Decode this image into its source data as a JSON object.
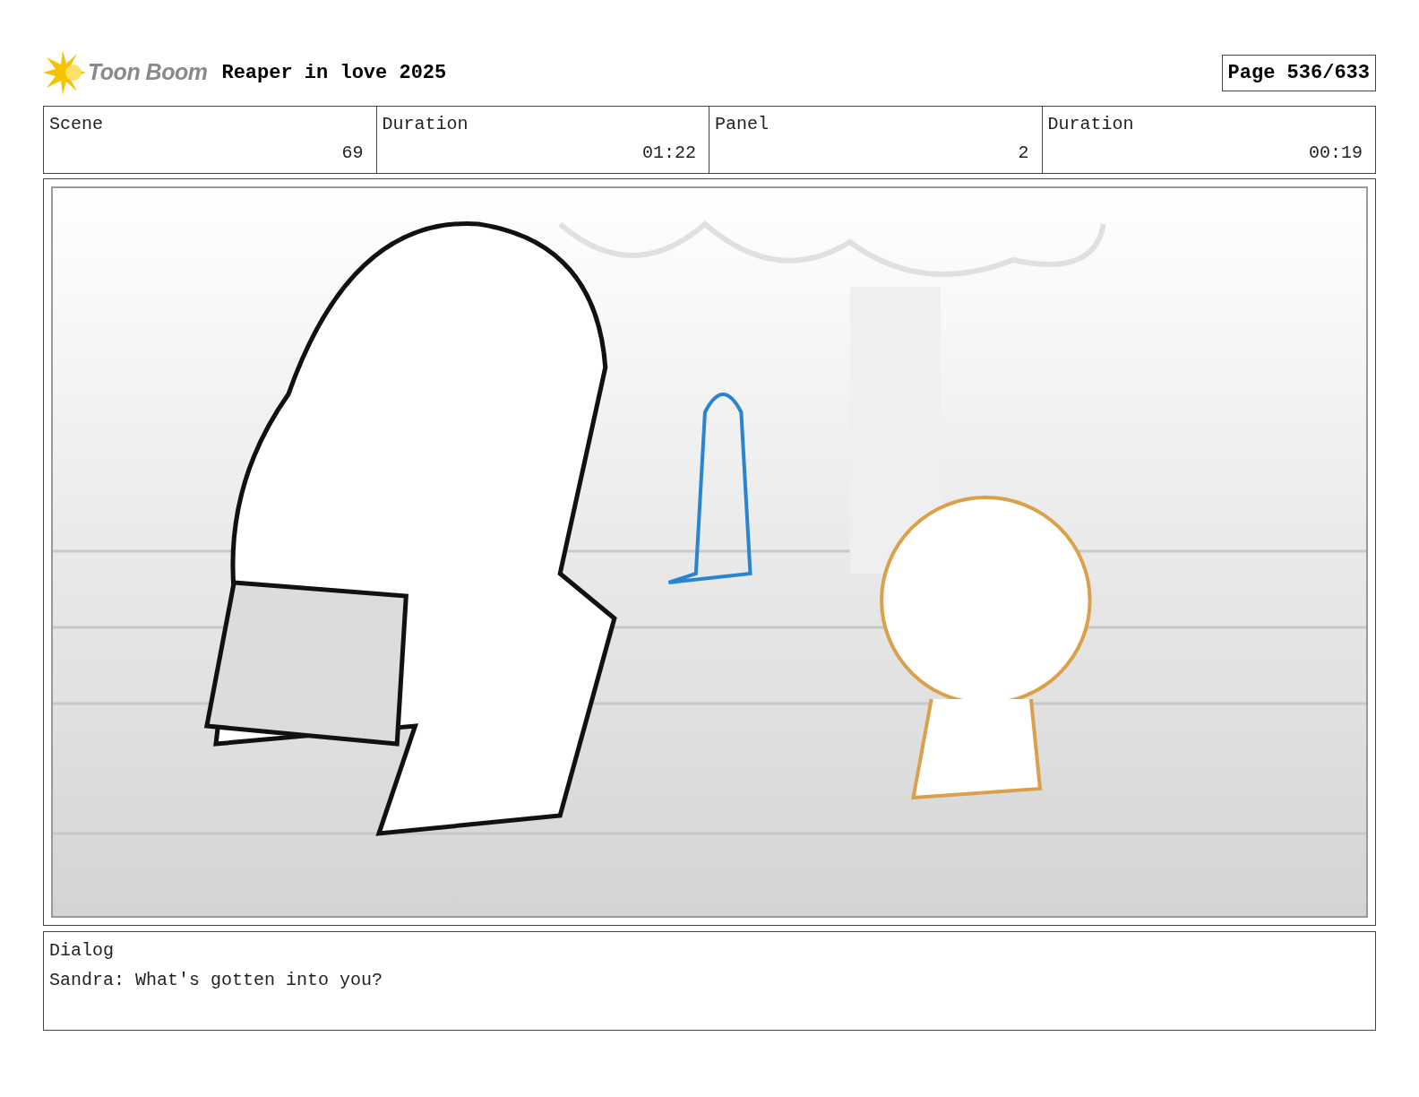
{
  "header": {
    "logo_text": "Toon Boom",
    "title": "Reaper in love 2025",
    "page": "Page 536/633"
  },
  "info": [
    {
      "label": "Scene",
      "value": "69"
    },
    {
      "label": "Duration",
      "value": "01:22"
    },
    {
      "label": "Panel",
      "value": "2"
    },
    {
      "label": "Duration",
      "value": "00:19"
    }
  ],
  "dialog": {
    "label": "Dialog",
    "text": "Sandra: What's gotten into you?"
  }
}
